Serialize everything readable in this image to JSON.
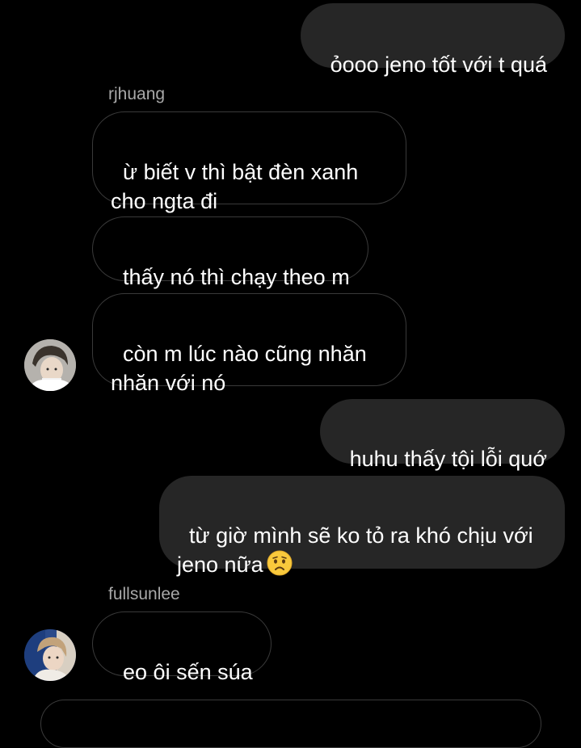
{
  "messages": [
    {
      "type": "sent",
      "text": "ỏooo jeno tốt với t quá"
    },
    {
      "type": "received",
      "sender": "rjhuang",
      "text": "ừ biết v thì bật đèn xanh\ncho ngta đi"
    },
    {
      "type": "received",
      "text": "thấy nó thì chạy theo m"
    },
    {
      "type": "received",
      "text": "còn m lúc nào cũng nhăn\nnhăn với nó"
    },
    {
      "type": "sent",
      "text": "huhu thấy tội lỗi quớ"
    },
    {
      "type": "sent",
      "text": "từ giờ mình sẽ ko tỏ ra khó chịu với\njeno nữa",
      "emoji": "worried-face"
    },
    {
      "type": "received",
      "sender": "fullsunlee",
      "text": "eo ôi sến súa"
    }
  ],
  "avatars": [
    {
      "user": "rjhuang",
      "icon": "user-avatar-photo"
    },
    {
      "user": "fullsunlee",
      "icon": "user-avatar-photo"
    }
  ],
  "colors": {
    "background": "#000000",
    "sent_bubble": "#262626",
    "received_border": "#3a3a3a",
    "sender_name": "#a8a8a8",
    "text": "#ffffff"
  }
}
